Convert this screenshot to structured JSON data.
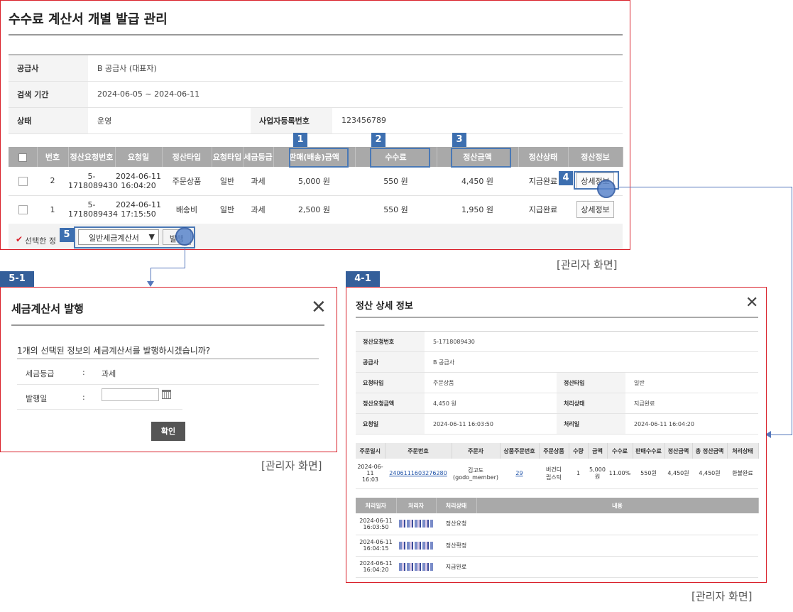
{
  "main": {
    "title": "수수료 계산서 개별 발급 관리",
    "info": {
      "supplier_label": "공급사",
      "supplier_value": "B 공급사 (대표자)",
      "period_label": "검색 기간",
      "period_value": "2024-06-05 ~ 2024-06-11",
      "status_label": "상태",
      "status_value": "운영",
      "bizno_label": "사업자등록번호",
      "bizno_value": "123456789"
    },
    "table": {
      "headers": [
        "번호",
        "정산요청번호",
        "요청일",
        "정산타입",
        "요청타입",
        "세금등급",
        "판매(배송)금액",
        "수수료",
        "정산금액",
        "정산상태",
        "정산정보"
      ],
      "rows": [
        {
          "no": "2",
          "req_no": "5-\n1718089430",
          "date": "2024-06-11\n16:04:20",
          "settle_type": "주문상품",
          "req_type": "일반",
          "tax": "과세",
          "sales": "5,000 원",
          "fee": "550 원",
          "amount": "4,450 원",
          "status": "지급완료",
          "action": "상세정보"
        },
        {
          "no": "1",
          "req_no": "5-\n1718089434",
          "date": "2024-06-11\n17:15:50",
          "settle_type": "배송비",
          "req_type": "일반",
          "tax": "과세",
          "sales": "2,500 원",
          "fee": "550 원",
          "amount": "1,950 원",
          "status": "지급완료",
          "action": "상세정보"
        }
      ]
    },
    "footer": {
      "selected_text": "선택한 정",
      "select_value": "일반세금계산서",
      "issue_button": "발행"
    },
    "caption": "[관리자 화면]"
  },
  "annotations": {
    "n1": "1",
    "n2": "2",
    "n3": "3",
    "n4": "4",
    "n5": "5",
    "tag51": "5-1",
    "tag41": "4-1",
    "color": "#3d6fb0"
  },
  "dialog51": {
    "title": "세금계산서 발행",
    "message": "1개의 선택된 정보의 세금계산서를 발행하시겠습니까?",
    "tax_label": "세금등급",
    "tax_value": "과세",
    "date_label": "발행일",
    "sep": ":",
    "confirm": "확인",
    "caption": "[관리자 화면]"
  },
  "dialog41": {
    "title": "정산 상세 정보",
    "info": {
      "req_no_label": "정산요청번호",
      "req_no_value": "5-1718089430",
      "supplier_label": "공급사",
      "supplier_value": "B 공급사",
      "req_type_label": "요청타입",
      "req_type_value": "주문상품",
      "settle_type_label": "정산타입",
      "settle_type_value": "일반",
      "req_amount_label": "정산요청금액",
      "req_amount_value": "4,450 원",
      "proc_status_label": "처리상태",
      "proc_status_value": "지급완료",
      "req_date_label": "요청일",
      "req_date_value": "2024-06-11 16:03:50",
      "proc_date_label": "처리일",
      "proc_date_value": "2024-06-11 16:04:20"
    },
    "orders": {
      "headers": [
        "주문일시",
        "주문번호",
        "주문자",
        "상품주문번호",
        "주문상품",
        "수량",
        "금액",
        "수수료",
        "판매수수료",
        "정산금액",
        "총 정산금액",
        "처리상태"
      ],
      "row": {
        "date": "2024-06-\n11\n16:03",
        "order_no": "2406111603276280",
        "orderer": "김고도\n(godo_member)",
        "item_no": "29",
        "item": "버건디\n립스틱",
        "qty": "1",
        "price": "5,000\n원",
        "fee_rate": "11.00%",
        "sales_fee": "550원",
        "settle": "4,450원",
        "total": "4,450원",
        "status": "환불완료"
      }
    },
    "history": {
      "headers": [
        "처리일자",
        "처리자",
        "처리상태",
        "내용"
      ],
      "rows": [
        {
          "date": "2024-06-11\n16:03:50",
          "status": "정산요청"
        },
        {
          "date": "2024-06-11\n16:04:15",
          "status": "정산확정"
        },
        {
          "date": "2024-06-11\n16:04:20",
          "status": "지급완료"
        }
      ]
    },
    "caption": "[관리자 화면]"
  }
}
